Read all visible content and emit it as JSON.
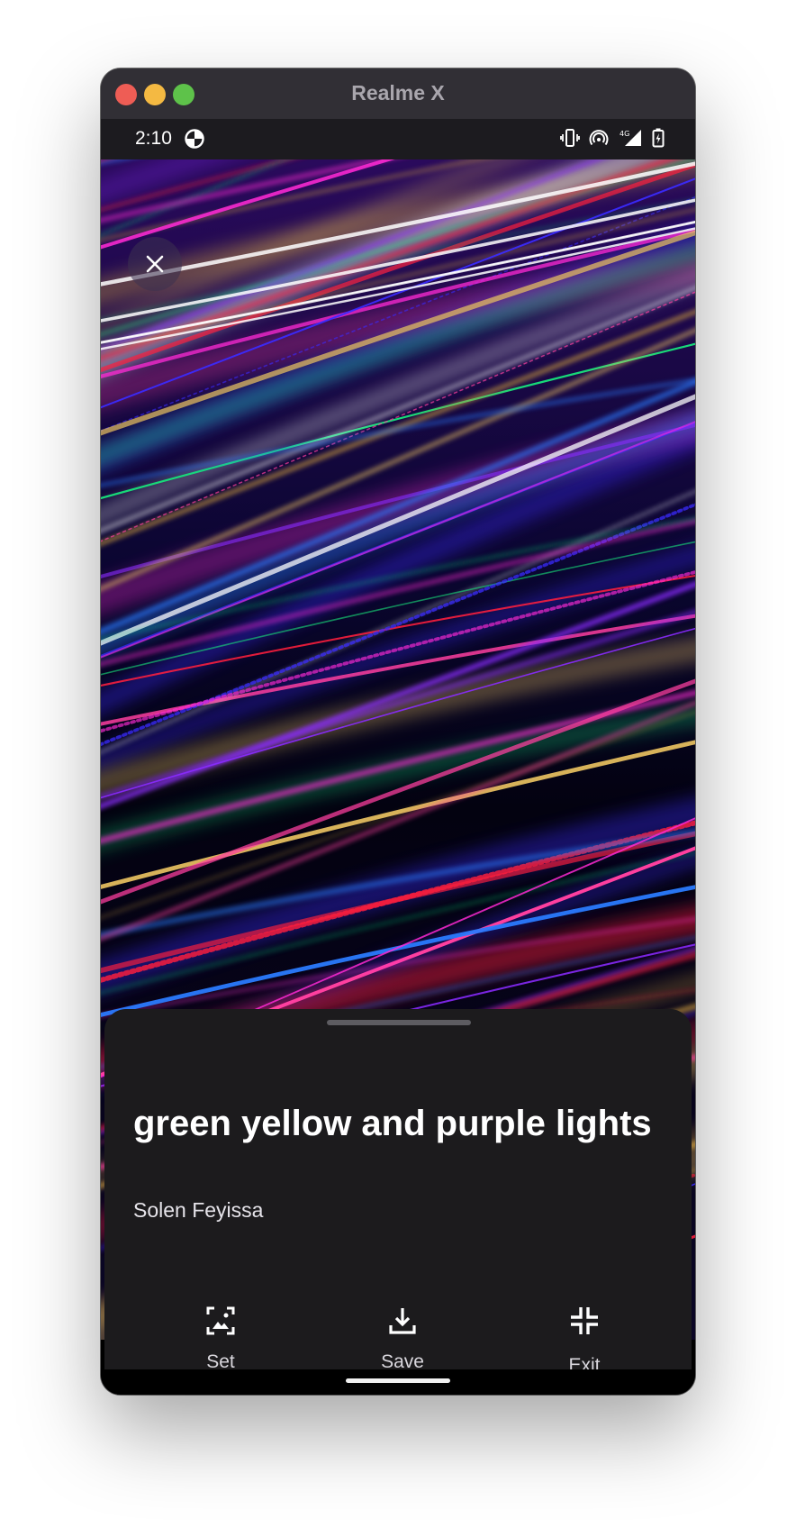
{
  "window": {
    "title": "Realme X"
  },
  "status_bar": {
    "time": "2:10"
  },
  "photo": {
    "title": "green yellow and purple lights",
    "author": "Solen Feyissa"
  },
  "actions": [
    {
      "label": "Set",
      "icon": "set-wallpaper-icon"
    },
    {
      "label": "Save",
      "icon": "download-icon"
    },
    {
      "label": "Exit",
      "icon": "exit-fullscreen-icon"
    }
  ],
  "colors": {
    "sheet_bg": "#1c1b1d",
    "status_bar_bg": "#1c1b1f",
    "title_bar_bg": "#312f35"
  }
}
